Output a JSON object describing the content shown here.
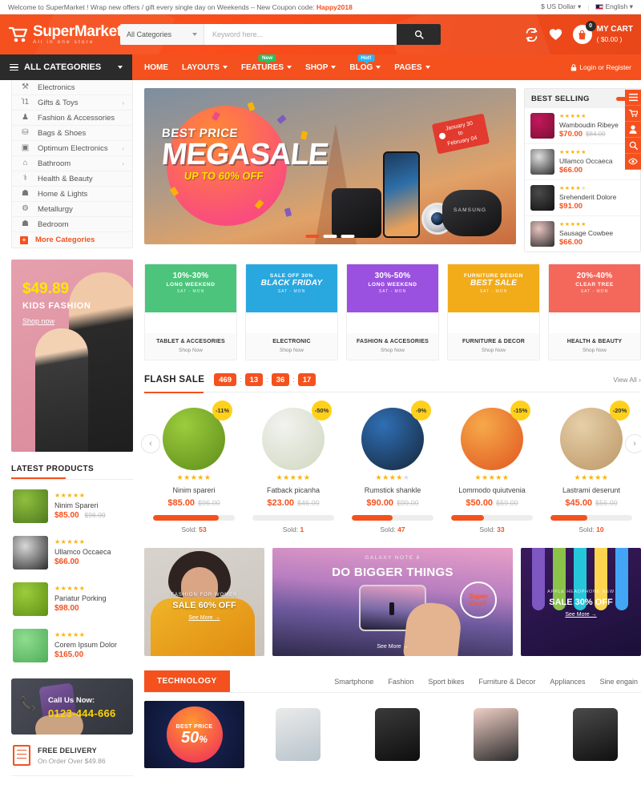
{
  "topbar": {
    "welcome_prefix": "Welcome to SuperMarket ! Wrap new offers / gift every single day on Weekends – New Coupon code: ",
    "coupon": "Happy2018",
    "currency": "$ US Dollar",
    "language": "English"
  },
  "header": {
    "logo_title": "SuperMarket",
    "logo_sub": "All in one store",
    "search_category": "All Categories",
    "search_placeholder": "Keyword here...",
    "search_value": "",
    "cart_count": "0",
    "cart_title": "MY CART",
    "cart_total": "( $0.00 )"
  },
  "nav": {
    "all_categories": "ALL CATEGORIES",
    "items": [
      {
        "label": "HOME",
        "caret": false,
        "badge": null
      },
      {
        "label": "LAYOUTS",
        "caret": true,
        "badge": null
      },
      {
        "label": "FEATURES",
        "caret": true,
        "badge": "New",
        "badge_type": "new"
      },
      {
        "label": "SHOP",
        "caret": true,
        "badge": null
      },
      {
        "label": "BLOG",
        "caret": true,
        "badge": "Hot!",
        "badge_type": "hot"
      },
      {
        "label": "PAGES",
        "caret": true,
        "badge": null
      }
    ],
    "login": "Login or Register"
  },
  "categories": [
    {
      "label": "Electronics",
      "icon": "plug-icon",
      "glyph": "⚒",
      "arrow": false
    },
    {
      "label": "Gifts & Toys",
      "icon": "gift-icon",
      "glyph": "Ἰ1",
      "arrow": true
    },
    {
      "label": "Fashion & Accessories",
      "icon": "dress-icon",
      "glyph": "♟",
      "arrow": false
    },
    {
      "label": "Bags & Shoes",
      "icon": "bag-icon",
      "glyph": "⛁",
      "arrow": false
    },
    {
      "label": "Optimum Electronics",
      "icon": "camera-icon",
      "glyph": "▣",
      "arrow": true
    },
    {
      "label": "Bathroom",
      "icon": "bath-icon",
      "glyph": "⌂",
      "arrow": true
    },
    {
      "label": "Health & Beauty",
      "icon": "health-icon",
      "glyph": "⚕",
      "arrow": false
    },
    {
      "label": "Home & Lights",
      "icon": "lamp-icon",
      "glyph": "☗",
      "arrow": false
    },
    {
      "label": "Metallurgy",
      "icon": "metal-icon",
      "glyph": "⚙",
      "arrow": false
    },
    {
      "label": "Bedroom",
      "icon": "bed-icon",
      "glyph": "☗",
      "arrow": false
    },
    {
      "label": "More Categories",
      "icon": "plus-icon",
      "glyph": "+",
      "arrow": false,
      "more": true
    }
  ],
  "hero": {
    "best_price": "BEST PRICE",
    "megasale": "MEGASALE",
    "upto": "UP TO 60% OFF",
    "tag_line1": "January 30",
    "tag_line2": "to",
    "tag_line3": "February 04",
    "brand": "SAMSUNG",
    "active_slide": 1,
    "slide_count": 3
  },
  "best_selling": {
    "title": "BEST SELLING",
    "items": [
      {
        "name": "Wamboudin Ribeye",
        "price": "$70.00",
        "old_price": "$84.00",
        "stars": 5,
        "color1": "#c2185b",
        "color2": "#7b1034"
      },
      {
        "name": "Ullamco Occaeca",
        "price": "$66.00",
        "old_price": "",
        "stars": 5,
        "color1": "#dedede",
        "color2": "#2a2a2a"
      },
      {
        "name": "Srehenderit Dolore",
        "price": "$91.00",
        "old_price": "",
        "stars": 4,
        "color1": "#4a4a4a",
        "color2": "#111111"
      },
      {
        "name": "Sausage Cowbee",
        "price": "$66.00",
        "old_price": "",
        "stars": 5,
        "color1": "#e8c4c0",
        "color2": "#2b2b2b"
      }
    ]
  },
  "float_icons": [
    "menu-icon",
    "cart-icon",
    "user-icon",
    "search-icon",
    "eye-icon"
  ],
  "promos": [
    {
      "t1": "10%-30%",
      "t2": "LONG WEEKEND",
      "t3": "SAT - MON",
      "name": "TABLET & ACCESORIES",
      "shop": "Shop Now",
      "color": "#4cc47c"
    },
    {
      "t1": "SALE OFF 30%",
      "t2": "BLACK FRIDAY",
      "t3": "SAT - MON",
      "name": "ELECTRONIC",
      "shop": "Shop Now",
      "color": "#29a8e0",
      "swap": true
    },
    {
      "t1": "30%-50%",
      "t2": "LONG WEEKEND",
      "t3": "SAT - MON",
      "name": "FASHION & ACCESORIES",
      "shop": "Shop Now",
      "color": "#9b51e0"
    },
    {
      "t1": "FURNITURE DESIGN",
      "t2": "BEST SALE",
      "t3": "SAT - MON",
      "name": "FURNITURE & DECOR",
      "shop": "Shop Now",
      "color": "#f2ac1a",
      "swap": true
    },
    {
      "t1": "20%-40%",
      "t2": "CLEAR TREE",
      "t3": "SAT - MON",
      "name": "HEALTH & BEAUTY",
      "shop": "Shop Now",
      "color": "#f4685c"
    }
  ],
  "kids_banner": {
    "price": "$49.89",
    "title": "KIDS FASHION",
    "cta": "Shop now"
  },
  "latest_products": {
    "title": "LATEST PRODUCTS",
    "items": [
      {
        "name": "Ninim Spareri",
        "price": "$85.00",
        "old_price": "$96.00",
        "stars": 5,
        "color1": "#8fbf3f",
        "color2": "#4e7a1e"
      },
      {
        "name": "Ullamco Occaeca",
        "price": "$66.00",
        "old_price": "",
        "stars": 5,
        "color1": "#d8d8d8",
        "color2": "#2a2a2a"
      },
      {
        "name": "Pariatur Porking",
        "price": "$98.00",
        "old_price": "",
        "stars": 5,
        "color1": "#9ccc3c",
        "color2": "#5e9113"
      },
      {
        "name": "Corem Ipsum Dolor",
        "price": "$165.00",
        "old_price": "",
        "stars": 5,
        "color1": "#8fdc8f",
        "color2": "#4fae59"
      }
    ]
  },
  "call_us": {
    "label": "Call Us Now:",
    "number": "0123-444-666"
  },
  "delivery": {
    "title": "FREE DELIVERY",
    "subtitle": "On Order Over $49.86"
  },
  "flash_sale": {
    "title": "FLASH SALE",
    "countdown": [
      "469",
      "13",
      "36",
      "17"
    ],
    "view_all": "View All",
    "items": [
      {
        "name": "Ninim spareri",
        "price": "$85.00",
        "old_price": "$96.00",
        "discount": "-11%",
        "sold_label": "Sold:",
        "sold": "53",
        "progress": 80,
        "stars": 5,
        "color1": "#9ccc3c",
        "color2": "#5d8c1a"
      },
      {
        "name": "Fatback picanha",
        "price": "$23.00",
        "old_price": "$46.00",
        "discount": "-50%",
        "sold_label": "Sold:",
        "sold": "1",
        "progress": 0,
        "stars": 5,
        "color1": "#f2f2ef",
        "color2": "#cfd8c0"
      },
      {
        "name": "Rumstick shankle",
        "price": "$90.00",
        "old_price": "$99.00",
        "discount": "-9%",
        "sold_label": "Sold:",
        "sold": "47",
        "progress": 50,
        "stars": 4,
        "color1": "#2f6fb5",
        "color2": "#16263a"
      },
      {
        "name": "Lommodo quiutvenia",
        "price": "$50.00",
        "old_price": "$59.00",
        "discount": "-15%",
        "sold_label": "Sold:",
        "sold": "33",
        "progress": 40,
        "stars": 5,
        "color1": "#f6a94a",
        "color2": "#e0561f"
      },
      {
        "name": "Lastrami deserunt",
        "price": "$45.00",
        "old_price": "$56.00",
        "discount": "-20%",
        "sold_label": "Sold:",
        "sold": "10",
        "progress": 45,
        "stars": 5,
        "color1": "#e6cfa8",
        "color2": "#bb9666"
      }
    ]
  },
  "mid_banners": {
    "b1": {
      "line1": "FASHION FOR WOMEN",
      "line2": "SALE 60% OFF",
      "cta": "See More  →"
    },
    "b2": {
      "line1": "GALAXY NOTE 8",
      "line2": "DO BIGGER THINGS",
      "deal1": "Super",
      "deal2": "Deal!",
      "cta": "See More  →"
    },
    "b3": {
      "line1": "APPLE HEADPHONE NEW",
      "line2": "SALE 30% OFF",
      "cta": "See More  →"
    }
  },
  "technology": {
    "button": "TECHNOLOGY",
    "tabs": [
      "Smartphone",
      "Fashion",
      "Sport bikes",
      "Furniture & Decor",
      "Appliances",
      "Sine engain"
    ],
    "promo": {
      "best_price": "BEST PRICE",
      "percent": "50",
      "percent_sign": "%"
    },
    "products": [
      {
        "name": "tablet-product",
        "color1": "#eaeaea",
        "color2": "#b8c4cc"
      },
      {
        "name": "speaker-product",
        "color1": "#3a3a3a",
        "color2": "#0e0e0e"
      },
      {
        "name": "watch-product",
        "color1": "#f0cfc6",
        "color2": "#2b2b2b"
      },
      {
        "name": "headphone-product",
        "color1": "#4a4a4a",
        "color2": "#101010"
      }
    ]
  }
}
